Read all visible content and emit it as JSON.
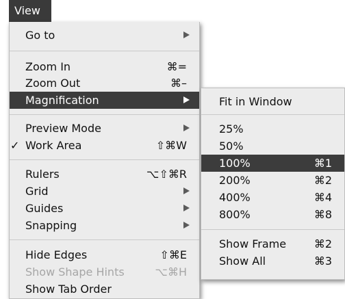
{
  "menubar": {
    "title": "View"
  },
  "main_menu": {
    "items": [
      {
        "label": "Go to",
        "has_submenu": true
      },
      {
        "label": "Zoom In",
        "shortcut": "⌘="
      },
      {
        "label": "Zoom Out",
        "shortcut": "⌘–"
      },
      {
        "label": "Magnification",
        "has_submenu": true,
        "highlighted": true
      },
      {
        "label": "Preview Mode",
        "has_submenu": true
      },
      {
        "label": "Work Area",
        "shortcut": "⇧⌘W",
        "checked": true,
        "check_mark": "✓"
      },
      {
        "label": "Rulers",
        "shortcut": "⌥⇧⌘R"
      },
      {
        "label": "Grid",
        "has_submenu": true
      },
      {
        "label": "Guides",
        "has_submenu": true
      },
      {
        "label": "Snapping",
        "has_submenu": true
      },
      {
        "label": "Hide Edges",
        "shortcut": "⇧⌘E"
      },
      {
        "label": "Show Shape Hints",
        "shortcut": "⌥⌘H",
        "disabled": true
      },
      {
        "label": "Show Tab Order"
      }
    ]
  },
  "sub_menu": {
    "items": [
      {
        "label": "Fit in Window"
      },
      {
        "label": "25%"
      },
      {
        "label": "50%"
      },
      {
        "label": "100%",
        "shortcut": "⌘1",
        "highlighted": true
      },
      {
        "label": "200%",
        "shortcut": "⌘2"
      },
      {
        "label": "400%",
        "shortcut": "⌘4"
      },
      {
        "label": "800%",
        "shortcut": "⌘8"
      },
      {
        "label": "Show Frame",
        "shortcut": "⌘2"
      },
      {
        "label": "Show All",
        "shortcut": "⌘3"
      }
    ]
  },
  "colors": {
    "menu_bg": "#ececec",
    "highlight_bg": "#3c3c3c",
    "highlight_text": "#ffffff",
    "disabled_text": "#a6a6a6",
    "separator": "#c9c9c9"
  }
}
